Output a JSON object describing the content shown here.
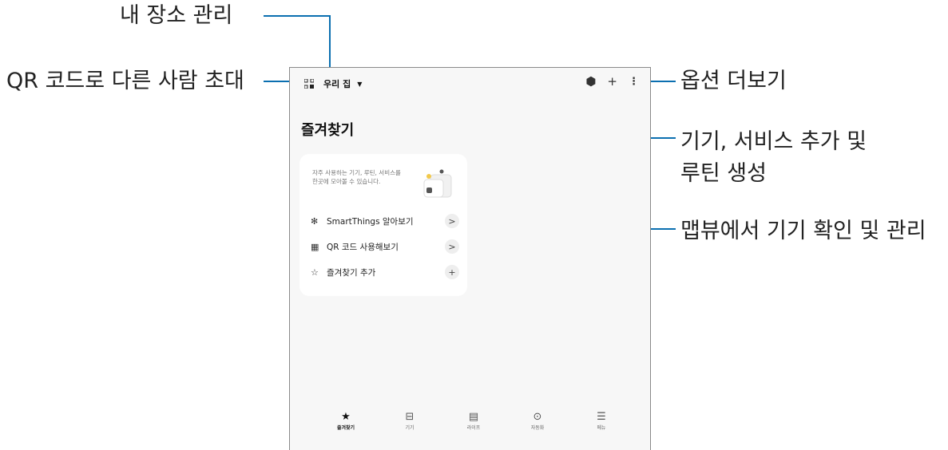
{
  "callouts": {
    "location_manage": "내 장소 관리",
    "qr_invite": "QR 코드로 다른 사람 초대",
    "more_options": "옵션 더보기",
    "add_device_line1": "기기, 서비스 추가 및",
    "add_device_line2": "루틴 생성",
    "map_view": "맵뷰에서 기기 확인 및 관리"
  },
  "header": {
    "home_name": "우리 집",
    "qr_icon": "qr-code-icon",
    "map_icon": "map-view-icon",
    "add_icon": "plus-icon",
    "more_icon": "more-vertical-icon"
  },
  "page": {
    "title": "즐겨찾기"
  },
  "card": {
    "description": "자주 사용하는 기기, 루틴, 서비스를 한곳에 모아볼 수 있습니다.",
    "rows": [
      {
        "icon": "smartthings-icon",
        "label": "SmartThings 알아보기",
        "action": ">"
      },
      {
        "icon": "qr-code-icon",
        "label": "QR 코드 사용해보기",
        "action": ">"
      },
      {
        "icon": "star-outline-icon",
        "label": "즐겨찾기 추가",
        "action": "+"
      }
    ]
  },
  "bottom_nav": [
    {
      "label": "즐겨찾기",
      "icon": "star-icon",
      "active": true
    },
    {
      "label": "기기",
      "icon": "devices-icon",
      "active": false
    },
    {
      "label": "라이프",
      "icon": "life-icon",
      "active": false
    },
    {
      "label": "자동화",
      "icon": "automation-icon",
      "active": false
    },
    {
      "label": "메뉴",
      "icon": "menu-icon",
      "active": false
    }
  ],
  "colors": {
    "callout_line": "#0b6fb0",
    "screen_bg": "#f7f7f7",
    "card_bg": "#ffffff"
  }
}
